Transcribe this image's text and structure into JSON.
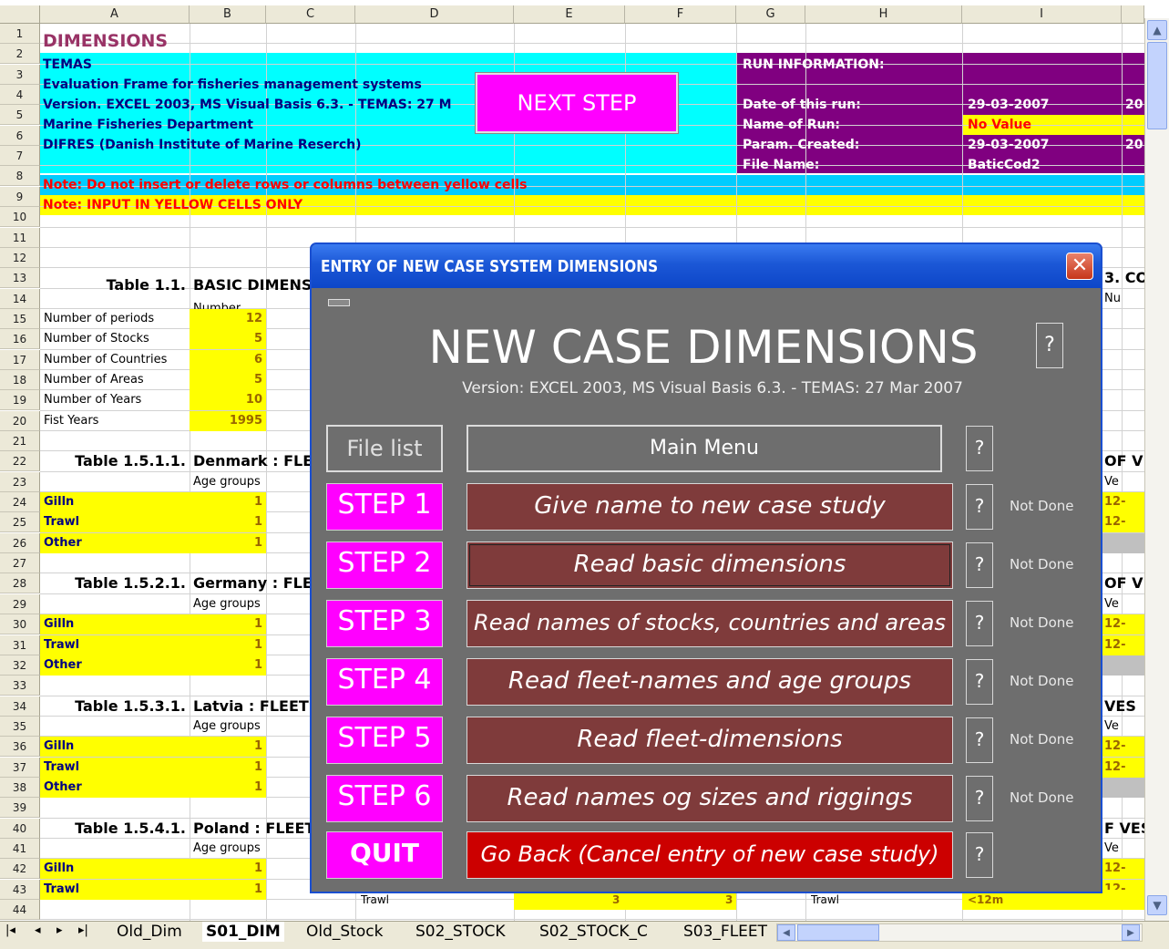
{
  "columns": [
    "A",
    "B",
    "C",
    "D",
    "E",
    "F",
    "G",
    "H",
    "I"
  ],
  "rows": [
    "1",
    "2",
    "3",
    "4",
    "5",
    "6",
    "7",
    "8",
    "9",
    "10",
    "11",
    "12",
    "13",
    "14",
    "15",
    "16",
    "17",
    "18",
    "19",
    "20",
    "21",
    "22",
    "23",
    "24",
    "25",
    "26",
    "27",
    "28",
    "29",
    "30",
    "31",
    "32",
    "33",
    "34",
    "35",
    "36",
    "37",
    "38",
    "39",
    "40",
    "41",
    "42",
    "43",
    "44"
  ],
  "sheet": {
    "title": "DIMENSIONS",
    "temas_lines": [
      "TEMAS",
      "Evaluation Frame for fisheries management systems",
      "Version. EXCEL 2003, MS Visual Basis 6.3. - TEMAS: 27 M",
      "Marine Fisheries Department",
      "DIFRES (Danish Institute of Marine Reserch)"
    ],
    "next_step": "NEXT STEP",
    "run_info": {
      "header": "RUN INFORMATION:",
      "date_label": "Date of this run:",
      "date_value": "29-03-2007",
      "date_extra": "20",
      "name_label": "Name of Run:",
      "name_value": "No Value",
      "param_label": "Param. Created:",
      "param_value": "29-03-2007",
      "param_extra": "20",
      "file_label": "File Name:",
      "file_value": "BaticCod2"
    },
    "note1": "Note: Do not insert or delete rows or columns between yellow cells",
    "note2": "Note: INPUT IN YELLOW CELLS ONLY",
    "table11_title": "Table 1.1.",
    "table11_name": "BASIC DIMENS",
    "number_label": "Number",
    "basic_rows": [
      {
        "label": "Number of periods",
        "value": "12"
      },
      {
        "label": "Number of Stocks",
        "value": "5"
      },
      {
        "label": "Number of Countries",
        "value": "6"
      },
      {
        "label": "Number of Areas",
        "value": "5"
      },
      {
        "label": "Number of Years",
        "value": "10"
      },
      {
        "label": "Fist Years",
        "value": "1995"
      }
    ],
    "fleet_tables": [
      {
        "title": "Table 1.5.1.1.",
        "name": "Denmark : FLE"
      },
      {
        "title": "Table 1.5.2.1.",
        "name": "Germany : FLE"
      },
      {
        "title": "Table 1.5.3.1.",
        "name": "Latvia : FLEETS"
      },
      {
        "title": "Table 1.5.4.1.",
        "name": "Poland : FLEET"
      }
    ],
    "age_groups_label": "Age groups",
    "fleet_names": [
      "Gilln",
      "Trawl",
      "Other"
    ],
    "fleet_value": "1",
    "right_fragments": {
      "r13": "3. CO",
      "r14": "Nu",
      "r22": "OF V",
      "r23": "Ve",
      "r24": "12-",
      "r25": "12-",
      "r28": "OF V",
      "r29": "Ve",
      "r30": "12-",
      "r31": "12-",
      "r34": "VES",
      "r35": "Ve",
      "r36": "12-",
      "r37": "12-",
      "r40": "F VES",
      "r41": "Ve",
      "r42": "12-",
      "r43": "12-"
    },
    "row43_d": "Trawl",
    "row43_e": "3",
    "row43_f": "3",
    "row43_h": "Trawl",
    "row43_i": "<12m"
  },
  "dialog": {
    "title": "ENTRY OF NEW CASE SYSTEM DIMENSIONS",
    "close": "✕",
    "heading": "NEW CASE DIMENSIONS",
    "help": "?",
    "version": "Version: EXCEL 2003, MS Visual Basis 6.3. - TEMAS: 27 Mar 2007",
    "file_list": "File list",
    "main_menu": "Main Menu",
    "steps": [
      {
        "label": "STEP 1",
        "action": "Give name to new case study",
        "status": "Not Done"
      },
      {
        "label": "STEP 2",
        "action": "Read basic dimensions",
        "status": "Not Done"
      },
      {
        "label": "STEP 3",
        "action": "Read names of stocks, countries and areas",
        "status": "Not Done"
      },
      {
        "label": "STEP 4",
        "action": "Read fleet-names and age groups",
        "status": "Not Done"
      },
      {
        "label": "STEP 5",
        "action": "Read fleet-dimensions",
        "status": "Not Done"
      },
      {
        "label": "STEP 6",
        "action": "Read names og sizes and riggings",
        "status": "Not Done"
      }
    ],
    "quit": "QUIT",
    "cancel": "Go Back (Cancel entry of new case study)"
  },
  "tabs": [
    "Old_Dim",
    "S01_DIM",
    "Old_Stock",
    "S02_STOCK",
    "S02_STOCK_C",
    "S03_FLEET"
  ],
  "active_tab": "S01_DIM",
  "tab_nav": [
    "|◂",
    "◂",
    "▸",
    "▸|"
  ]
}
